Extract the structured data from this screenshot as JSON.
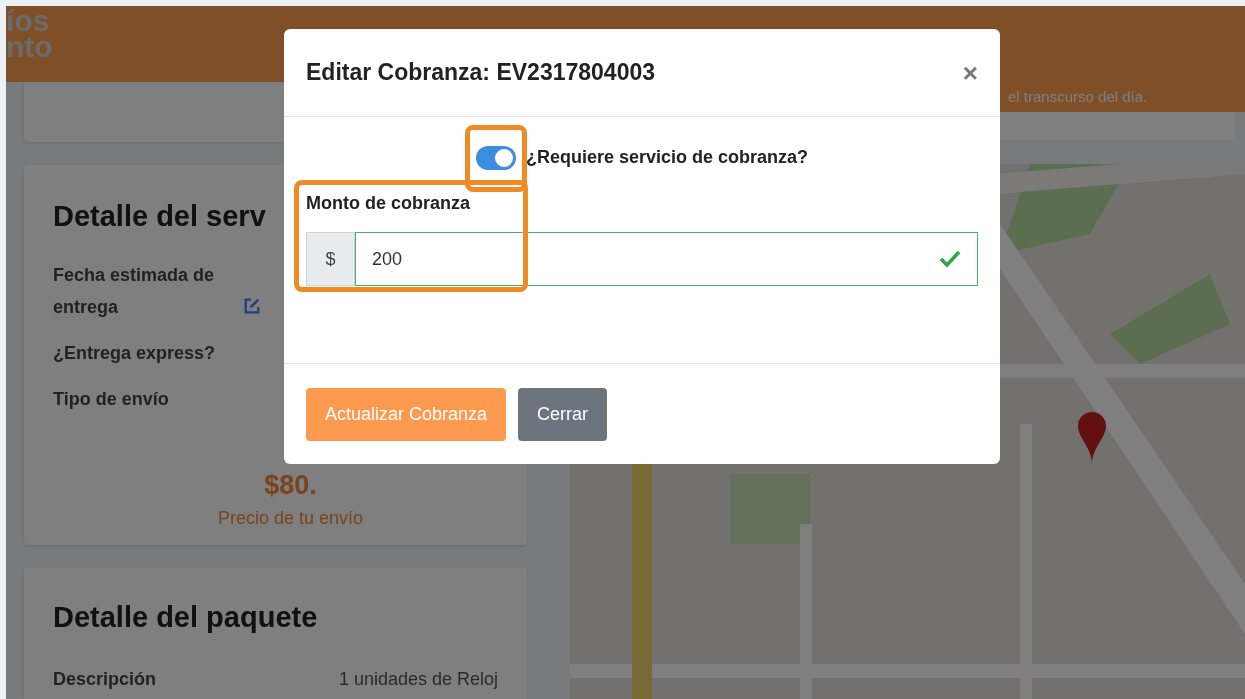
{
  "header": {
    "logo_lines": [
      "íos",
      "nto"
    ],
    "notice": "el transcurso del día."
  },
  "service_card": {
    "title": "Detalle del serv",
    "fields": [
      {
        "label": "Fecha estimada de entrega",
        "editable": true
      },
      {
        "label": "¿Entrega express?",
        "editable": false
      },
      {
        "label": "Tipo de envío",
        "editable": false
      }
    ],
    "price": "$80.",
    "price_caption": "Precio de tu envío"
  },
  "package_card": {
    "title": "Detalle del paquete",
    "rows": [
      {
        "label": "Descripción",
        "value": "1 unidades de Reloj"
      }
    ]
  },
  "modal": {
    "title": "Editar Cobranza: EV2317804003",
    "close": "×",
    "toggle": {
      "label": "¿Requiere servicio de cobranza?",
      "on": true,
      "highlighted": true
    },
    "amount": {
      "label": "Monto de cobranza",
      "prefix": "$",
      "value": "200",
      "valid": true,
      "highlighted": true
    },
    "buttons": [
      {
        "label": "Actualizar Cobranza",
        "kind": "primary"
      },
      {
        "label": "Cerrar",
        "kind": "secondary"
      }
    ]
  }
}
